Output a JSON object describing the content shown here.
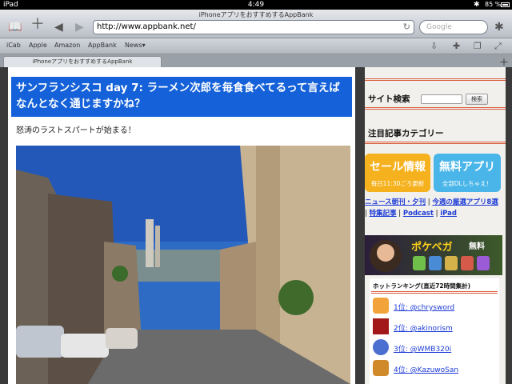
{
  "status": {
    "device": "iPad",
    "time": "4:49",
    "battery": "85 %"
  },
  "browser": {
    "page_title": "iPhoneアプリをおすすめするAppBank",
    "url": "http://www.appbank.net/",
    "search_placeholder": "Google"
  },
  "bookmarks": [
    "iCab",
    "Apple",
    "Amazon",
    "AppBank",
    "News▾"
  ],
  "tab": {
    "label": "iPhoneアプリをおすすめするAppBank"
  },
  "article": {
    "headline": "サンフランシスコ day 7: ラーメン次郎を毎食食べてるって言えばなんとなく通じますかね？",
    "lead": "怒涛のラストスパートが始まる！"
  },
  "sidebar": {
    "search_title": "サイト検索",
    "search_button": "検索",
    "categories_title": "注目記事カテゴリー",
    "banner_sale": {
      "title": "セール情報",
      "sub": "毎日11:30ごろ更新"
    },
    "banner_free": {
      "title": "無料アプリ",
      "sub": "全部DLしちゃえ！"
    },
    "links": [
      "ニュース朝刊・夕刊",
      "今週の厳選アプリ8選",
      "特集記事",
      "Podcast",
      "iPad"
    ],
    "ad": {
      "title": "ポケベガ",
      "tag": "無料"
    },
    "ranking": {
      "title": "ホットランキング(直近72時間集計)",
      "items": [
        {
          "label": "1位: @chrysword",
          "color": "#f2a33a"
        },
        {
          "label": "2位: @akinorism",
          "color": "#a31818"
        },
        {
          "label": "3位: @WMB320i",
          "color": "#4a6fd1"
        },
        {
          "label": "4位: @KazuwoSan",
          "color": "#d08a2a"
        }
      ]
    }
  }
}
